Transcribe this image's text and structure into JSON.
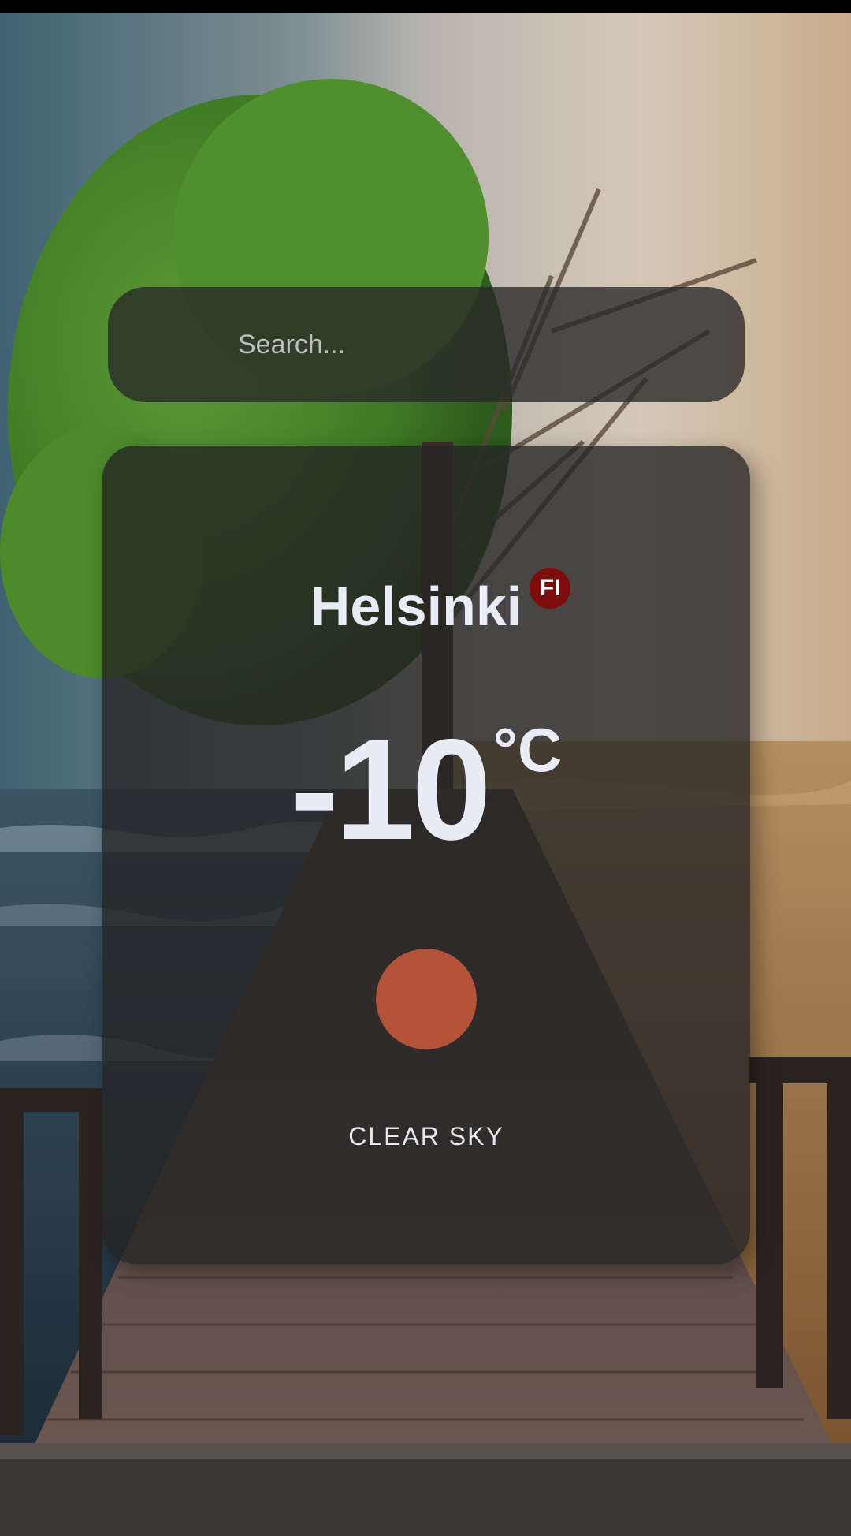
{
  "search": {
    "placeholder": "Search...",
    "value": ""
  },
  "weather": {
    "city": "Helsinki",
    "country_code": "FI",
    "temperature": "-10",
    "unit": "°C",
    "condition": "CLEAR SKY",
    "condition_icon": "sun-icon"
  },
  "colors": {
    "card_bg": "#242424",
    "text": "#e9ebf6",
    "country_badge": "#7d0c0c",
    "sun": "#b5523a"
  }
}
